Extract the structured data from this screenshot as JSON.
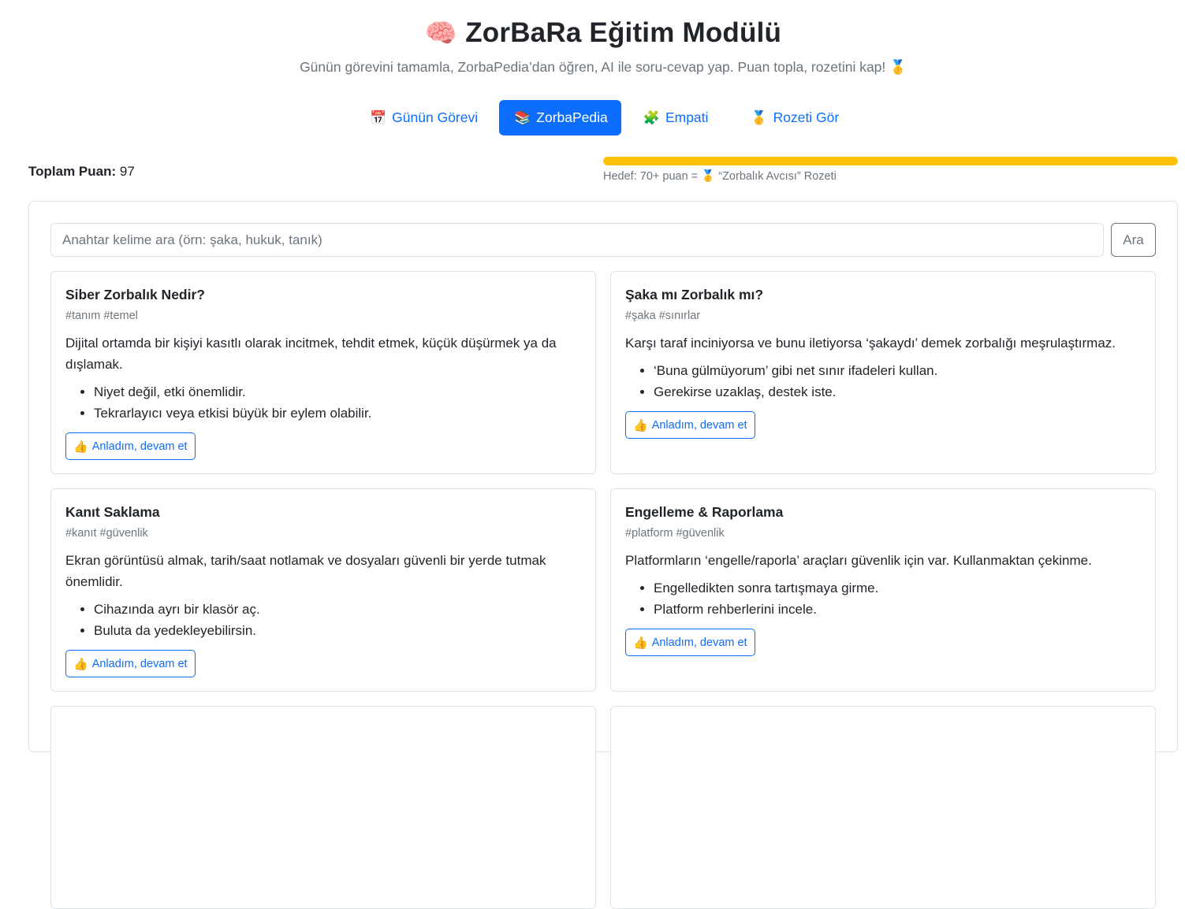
{
  "header": {
    "title_icon": "🧠",
    "title": "ZorBaRa Eğitim Modülü",
    "subtitle": "Günün görevini tamamla, ZorbaPedia’dan öğren, AI ile soru-cevap yap. Puan topla, rozetini kap! 🥇"
  },
  "tabs": [
    {
      "icon": "📅",
      "label": "Günün Görevi",
      "active": false
    },
    {
      "icon": "📚",
      "label": "ZorbaPedia",
      "active": true
    },
    {
      "icon": "🧩",
      "label": "Empati",
      "active": false
    },
    {
      "icon": "🥇",
      "label": "Rozeti Gör",
      "active": false
    }
  ],
  "score": {
    "label": "Toplam Puan:",
    "value": "97"
  },
  "progress": {
    "fraction": 1.0,
    "color": "#ffc107",
    "target_text": "Hedef: 70+ puan = 🥇 “Zorbalık Avcısı” Rozeti"
  },
  "search": {
    "placeholder": "Anahtar kelime ara (örn: şaka, hukuk, tanık)",
    "value": "",
    "button_label": "Ara"
  },
  "cards": [
    {
      "title": "Siber Zorbalık Nedir?",
      "tags": "#tanım #temel",
      "text": "Dijital ortamda bir kişiyi kasıtlı olarak incitmek, tehdit etmek, küçük düşürmek ya da dışlamak.",
      "bullets": [
        "Niyet değil, etki önemlidir.",
        "Tekrarlayıcı veya etkisi büyük bir eylem olabilir."
      ],
      "button_icon": "👍",
      "button_label": "Anladım, devam et"
    },
    {
      "title": "Şaka mı Zorbalık mı?",
      "tags": "#şaka #sınırlar",
      "text": "Karşı taraf inciniyorsa ve bunu iletiyorsa ‘şakaydı’ demek zorbalığı meşrulaştırmaz.",
      "bullets": [
        "‘Buna gülmüyorum’ gibi net sınır ifadeleri kullan.",
        "Gerekirse uzaklaş, destek iste."
      ],
      "button_icon": "👍",
      "button_label": "Anladım, devam et"
    },
    {
      "title": "Kanıt Saklama",
      "tags": "#kanıt #güvenlik",
      "text": "Ekran görüntüsü almak, tarih/saat notlamak ve dosyaları güvenli bir yerde tutmak önemlidir.",
      "bullets": [
        "Cihazında ayrı bir klasör aç.",
        "Buluta da yedekleyebilirsin."
      ],
      "button_icon": "👍",
      "button_label": "Anladım, devam et"
    },
    {
      "title": "Engelleme & Raporlama",
      "tags": "#platform #güvenlik",
      "text": "Platformların ‘engelle/raporla’ araçları güvenlik için var. Kullanmaktan çekinme.",
      "bullets": [
        "Engelledikten sonra tartışmaya girme.",
        "Platform rehberlerini incele."
      ],
      "button_icon": "👍",
      "button_label": "Anladım, devam et"
    }
  ]
}
